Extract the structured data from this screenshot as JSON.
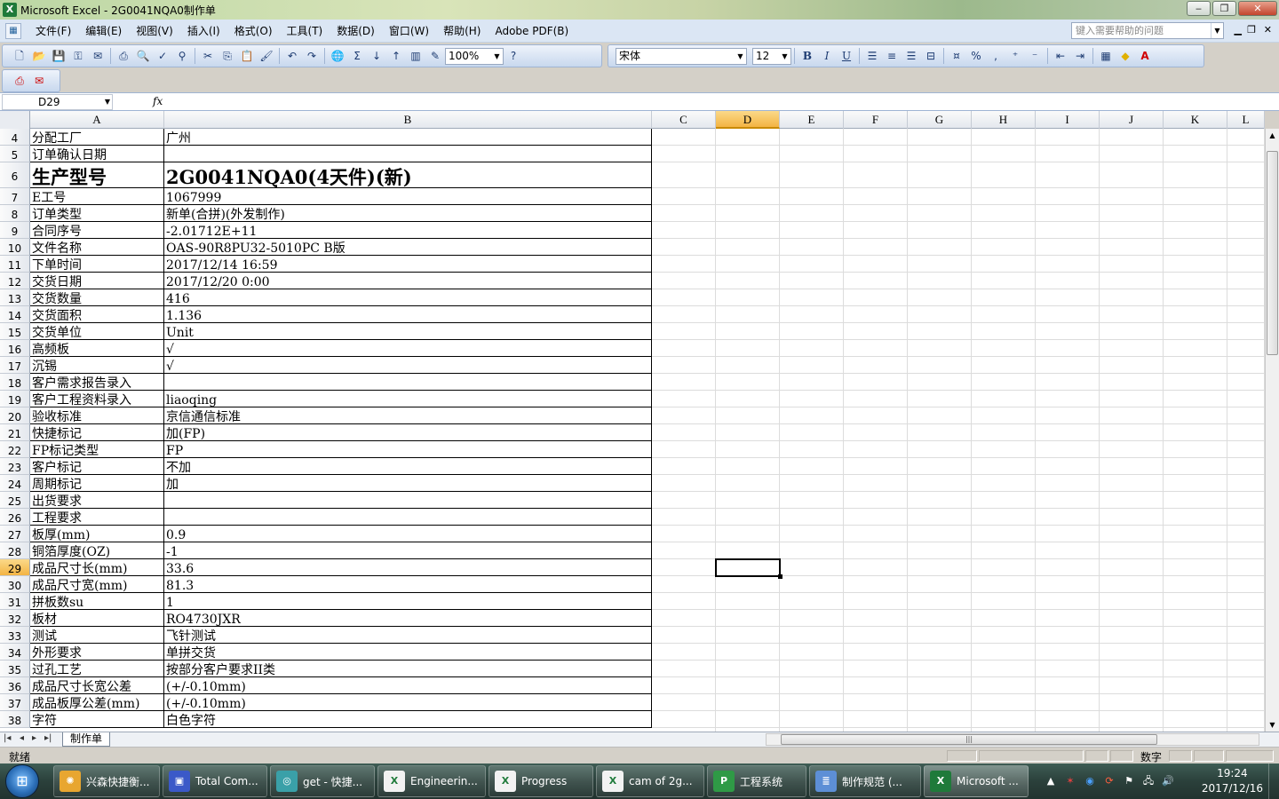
{
  "window": {
    "title": "Microsoft Excel - 2G0041NQA0制作单",
    "minimize": "‒",
    "restore": "❐",
    "close": "✕"
  },
  "menu": {
    "items": [
      "文件(F)",
      "编辑(E)",
      "视图(V)",
      "插入(I)",
      "格式(O)",
      "工具(T)",
      "数据(D)",
      "窗口(W)",
      "帮助(H)",
      "Adobe PDF(B)"
    ],
    "help_placeholder": "键入需要帮助的问题"
  },
  "toolbar": {
    "zoom": "100%",
    "font_name": "宋体",
    "font_size": "12",
    "bold": "B",
    "italic": "I",
    "underline": "U",
    "percent": "%",
    "comma": ","
  },
  "formula_bar": {
    "name_box": "D29",
    "fx": "fx",
    "formula": ""
  },
  "columns": [
    "A",
    "B",
    "C",
    "D",
    "E",
    "F",
    "G",
    "H",
    "I",
    "J",
    "K",
    "L"
  ],
  "selected_column": "D",
  "rows": [
    {
      "n": "4",
      "a": "分配工厂",
      "b": "广州"
    },
    {
      "n": "5",
      "a": "订单确认日期",
      "b": ""
    },
    {
      "n": "6",
      "a": "生产型号",
      "b": "2G0041NQA0(4天件)(新)"
    },
    {
      "n": "7",
      "a": "E工号",
      "b": "1067999"
    },
    {
      "n": "8",
      "a": "订单类型",
      "b": "新单(合拼)(外发制作)"
    },
    {
      "n": "9",
      "a": "合同序号",
      "b": "-2.01712E+11"
    },
    {
      "n": "10",
      "a": "文件名称",
      "b": "OAS-90R8PU32-5010PC B版"
    },
    {
      "n": "11",
      "a": "下单时间",
      "b": "2017/12/14 16:59"
    },
    {
      "n": "12",
      "a": "交货日期",
      "b": "2017/12/20 0:00"
    },
    {
      "n": "13",
      "a": "交货数量",
      "b": "416"
    },
    {
      "n": "14",
      "a": "交货面积",
      "b": "1.136"
    },
    {
      "n": "15",
      "a": "交货单位",
      "b": "Unit"
    },
    {
      "n": "16",
      "a": "高频板",
      "b": "√"
    },
    {
      "n": "17",
      "a": "沉锡",
      "b": "√"
    },
    {
      "n": "18",
      "a": "客户需求报告录入",
      "b": ""
    },
    {
      "n": "19",
      "a": "客户工程资料录入",
      "b": "liaoqing"
    },
    {
      "n": "20",
      "a": "验收标准",
      "b": "京信通信标准"
    },
    {
      "n": "21",
      "a": "快捷标记",
      "b": "加(FP)"
    },
    {
      "n": "22",
      "a": "FP标记类型",
      "b": "FP"
    },
    {
      "n": "23",
      "a": "客户标记",
      "b": "不加"
    },
    {
      "n": "24",
      "a": "周期标记",
      "b": "加"
    },
    {
      "n": "25",
      "a": "出货要求",
      "b": ""
    },
    {
      "n": "26",
      "a": "工程要求",
      "b": ""
    },
    {
      "n": "27",
      "a": "板厚(mm)",
      "b": "0.9"
    },
    {
      "n": "28",
      "a": "铜箔厚度(OZ)",
      "b": "-1"
    },
    {
      "n": "29",
      "a": "成品尺寸长(mm)",
      "b": "33.6"
    },
    {
      "n": "30",
      "a": "成品尺寸宽(mm)",
      "b": "81.3"
    },
    {
      "n": "31",
      "a": "拼板数su",
      "b": "1"
    },
    {
      "n": "32",
      "a": "板材",
      "b": "RO4730JXR"
    },
    {
      "n": "33",
      "a": "测试",
      "b": "飞针测试"
    },
    {
      "n": "34",
      "a": "外形要求",
      "b": "单拼交货"
    },
    {
      "n": "35",
      "a": "过孔工艺",
      "b": "按部分客户要求II类"
    },
    {
      "n": "36",
      "a": "成品尺寸长宽公差",
      "b": "(+/-0.10mm)"
    },
    {
      "n": "37",
      "a": "成品板厚公差(mm)",
      "b": "(+/-0.10mm)"
    },
    {
      "n": "38",
      "a": "字符",
      "b": "白色字符"
    }
  ],
  "selected_row": "29",
  "sheet_tab": "制作单",
  "status": {
    "ready": "就绪",
    "mode": "数字"
  },
  "taskbar": {
    "items": [
      {
        "label": "兴森快捷衡...",
        "icon": "sun-icon",
        "color": "#e8a630"
      },
      {
        "label": "Total Com...",
        "icon": "floppy-icon",
        "color": "#3b59c8"
      },
      {
        "label": "get - 快捷...",
        "icon": "eye-icon",
        "color": "#3aa0a8"
      },
      {
        "label": "Engineerin...",
        "icon": "excel-icon",
        "color": "#f2f2f2"
      },
      {
        "label": "Progress",
        "icon": "excel-icon",
        "color": "#f2f2f2"
      },
      {
        "label": "cam of 2g...",
        "icon": "excel-icon",
        "color": "#f2f2f2"
      },
      {
        "label": "工程系统",
        "icon": "p-icon",
        "color": "#2f9a46"
      },
      {
        "label": "制作规范 (...",
        "icon": "notepad-icon",
        "color": "#5d8fd6"
      },
      {
        "label": "Microsoft ...",
        "icon": "excel-icon",
        "color": "#1f7a3a"
      }
    ],
    "time": "19:24",
    "date": "2017/12/16"
  }
}
